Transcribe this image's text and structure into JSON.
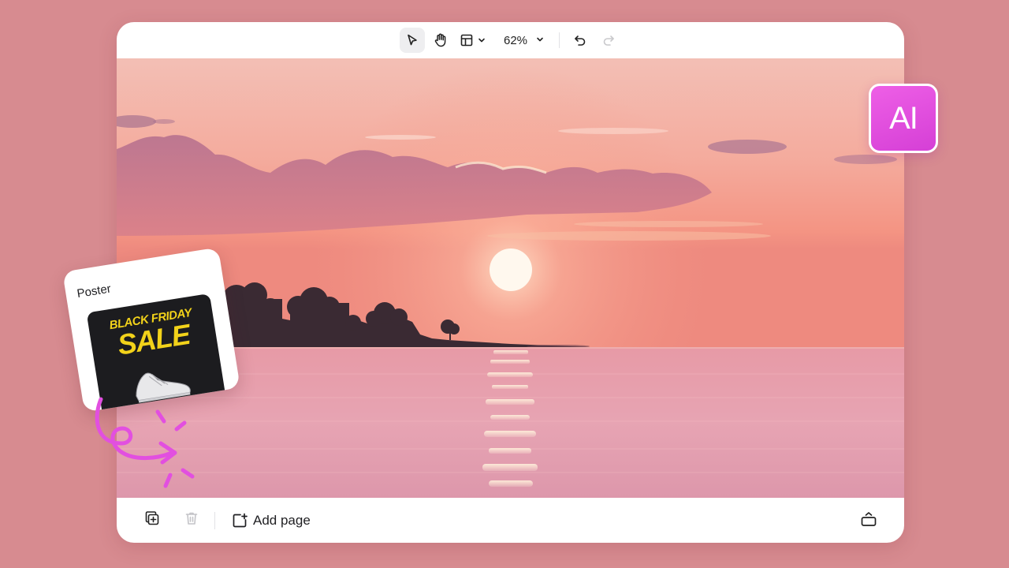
{
  "toolbar": {
    "zoom_label": "62%",
    "tools": [
      {
        "name": "select-tool",
        "icon": "cursor-icon",
        "active": true
      },
      {
        "name": "hand-tool",
        "icon": "hand-icon",
        "active": false
      },
      {
        "name": "layout-tool",
        "icon": "layout-icon",
        "active": false
      }
    ],
    "undo_icon": "undo-icon",
    "redo_icon": "redo-icon",
    "redo_enabled": false
  },
  "canvas": {
    "image_description_icon": "sunset-over-sea"
  },
  "bottombar": {
    "duplicate_icon": "duplicate-page-icon",
    "delete_icon": "trash-icon",
    "delete_enabled": false,
    "add_page_label": "Add page",
    "collapse_icon": "collapse-panel-icon"
  },
  "ai_badge": {
    "label": "AI",
    "color": "#e24fe0"
  },
  "poster_card": {
    "title": "Poster",
    "thumb_line1": "BLACK FRIDAY",
    "thumb_line2": "SALE",
    "accent_color": "#f2d21a"
  },
  "colors": {
    "background": "#d78b90",
    "window": "#ffffff",
    "deco_arrow": "#e24fe0"
  }
}
